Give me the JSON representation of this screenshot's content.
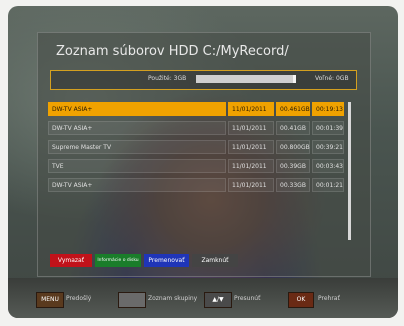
{
  "header": {
    "title": "Zoznam súborov  HDD C:/MyRecord/"
  },
  "usage": {
    "used_label": "Použité: 3GB",
    "free_label": "Voľné: 0GB",
    "used_fraction": 0.97
  },
  "files": [
    {
      "name": "DW-TV ASIA+",
      "date": "11/01/2011",
      "size": "00.461GB",
      "duration": "00:19:13"
    },
    {
      "name": "DW-TV ASIA+",
      "date": "11/01/2011",
      "size": "00.41GB",
      "duration": "00:01:39"
    },
    {
      "name": "Supreme Master TV",
      "date": "11/01/2011",
      "size": "00.800GB",
      "duration": "00:39:21"
    },
    {
      "name": "TVE",
      "date": "11/01/2011",
      "size": "00.39GB",
      "duration": "00:03:43"
    },
    {
      "name": "DW-TV ASIA+",
      "date": "11/01/2011",
      "size": "00.33GB",
      "duration": "00:01:21"
    }
  ],
  "actions": {
    "red": "Vymazať",
    "green": "Informácie o disku",
    "blue": "Premenovať",
    "grey": "Zamknúť"
  },
  "hints": {
    "menu_key": "MENU",
    "menu_label": "Predošlý",
    "list_label": "Zoznam skupiny",
    "arrows_key": "▲/▼",
    "arrows_label": "Presunúť",
    "ok_key": "OK",
    "ok_label": "Prehrať"
  },
  "colors": {
    "selected": "#f0a200",
    "red": "#c1121a",
    "green": "#1a7d2a",
    "blue": "#1f35b8"
  }
}
